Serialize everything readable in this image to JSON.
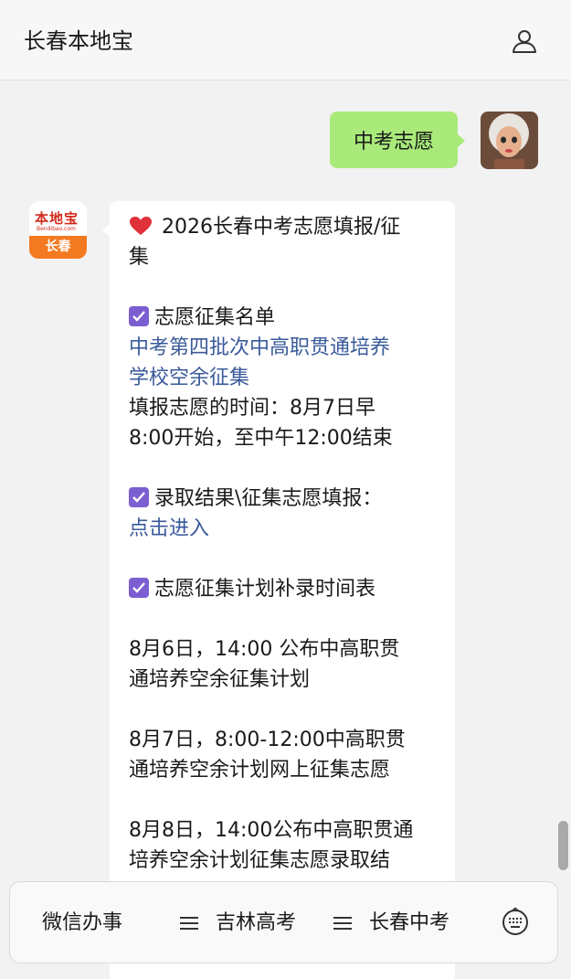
{
  "header": {
    "title": "长春本地宝"
  },
  "conversation": {
    "outgoing": {
      "text": "中考志愿"
    },
    "bot": {
      "avatar": {
        "logo": "本地宝",
        "logo_sub": "Bendibao.com",
        "city": "长春"
      },
      "title_line1": "2026长春中考志愿填报/征",
      "title_line2": "集",
      "sec1_heading": "志愿征集名单",
      "sec1_link_line1": "中考第四批次中高职贯通培养",
      "sec1_link_line2": "学校空余征集",
      "sec1_text_line1": "填报志愿的时间：8月7日早",
      "sec1_text_line2": "8:00开始，至中午12:00结束",
      "sec2_heading": "录取结果\\征集志愿填报：",
      "sec2_link": "点击进入",
      "sec3_heading": "志愿征集计划补录时间表",
      "sched1_line1": "8月6日，14:00 公布中高职贯",
      "sched1_line2": "通培养空余征集计划",
      "sched2_line1": "8月7日，8:00-12:00中高职贯",
      "sched2_line2": "通培养空余计划网上征集志愿",
      "sched3_line1": "8月8日，14:00公布中高职贯通",
      "sched3_line2": "培养空余计划征集志愿录取结"
    }
  },
  "bottom_menu": {
    "item1": "微信办事",
    "item2": "吉林高考",
    "item3": "长春中考"
  },
  "icons": {
    "profile": "person-icon",
    "heart": "heart-icon",
    "check": "checkbox-icon",
    "menu": "menu-lines-icon",
    "keyboard": "keyboard-icon"
  },
  "colors": {
    "outgoing_bubble": "#a9ea7a",
    "link": "#3a5a9a",
    "check": "#7b5fd1",
    "heart": "#e0303a",
    "brand_orange": "#f47a21"
  }
}
